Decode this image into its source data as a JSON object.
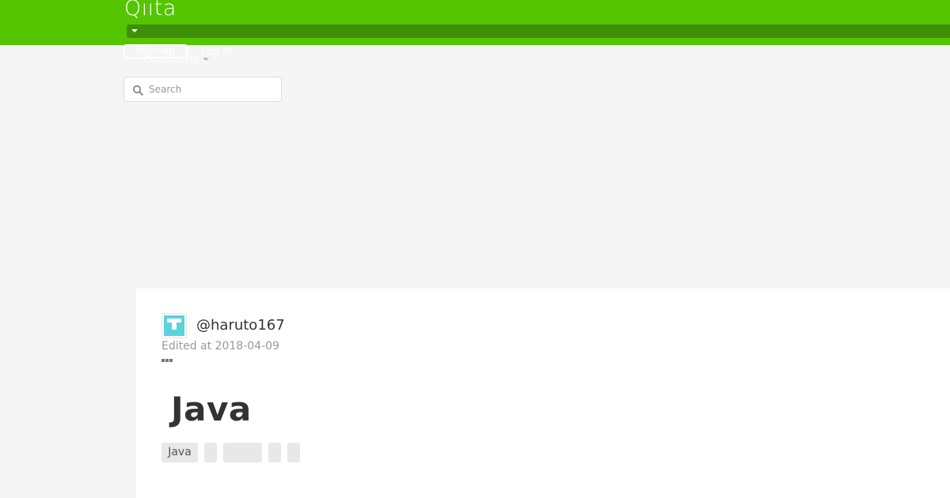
{
  "header": {
    "logo_text": "Qiita",
    "signup_label": "Sign up",
    "login_label": "Log in",
    "community_label": "Community"
  },
  "search": {
    "placeholder": "Search",
    "value": ""
  },
  "article": {
    "author": "@haruto167",
    "edited": "Edited at 2018-04-09",
    "title": "Java",
    "tags": [
      "Java",
      "",
      "",
      "",
      ""
    ]
  },
  "colors": {
    "brand": "#55c500",
    "brand_dark": "#3f8f0a",
    "avatar": "#5ad3dc"
  }
}
